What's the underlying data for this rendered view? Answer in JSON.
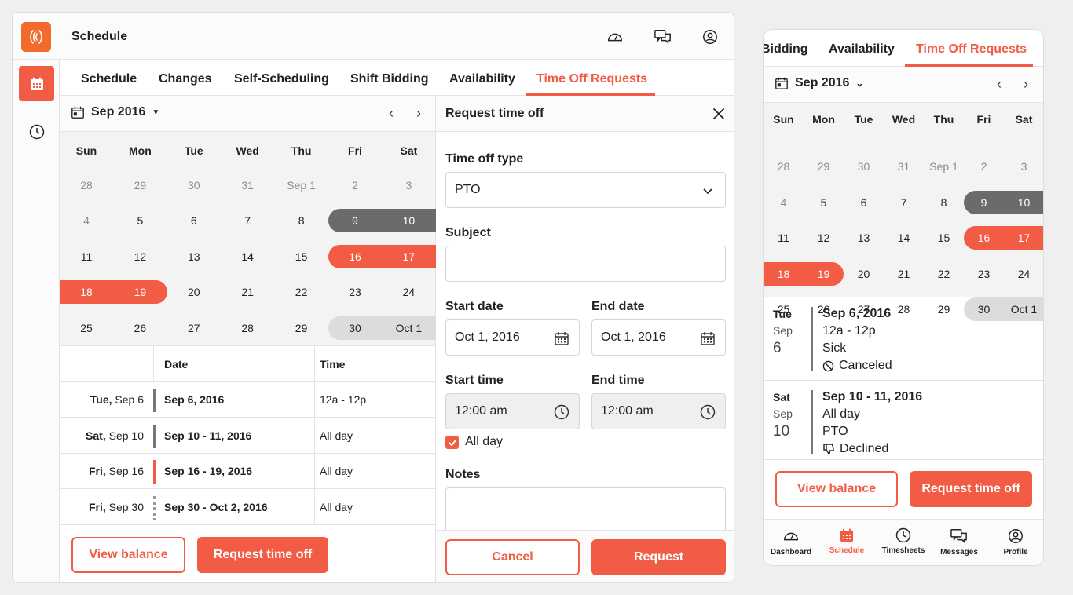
{
  "app": {
    "title": "Schedule"
  },
  "tabs": [
    "Schedule",
    "Changes",
    "Self-Scheduling",
    "Shift Bidding",
    "Availability",
    "Time Off Requests"
  ],
  "active_tab": "Time Off Requests",
  "calendar": {
    "month_label": "Sep 2016",
    "weekdays": [
      "Sun",
      "Mon",
      "Tue",
      "Wed",
      "Thu",
      "Fri",
      "Sat"
    ],
    "weeks": [
      [
        "28",
        "29",
        "30",
        "31",
        "Sep 1",
        "2",
        "3"
      ],
      [
        "4",
        "5",
        "6",
        "7",
        "8",
        "9",
        "10"
      ],
      [
        "11",
        "12",
        "13",
        "14",
        "15",
        "16",
        "17"
      ],
      [
        "18",
        "19",
        "20",
        "21",
        "22",
        "23",
        "24"
      ],
      [
        "25",
        "26",
        "27",
        "28",
        "29",
        "30",
        "Oct 1"
      ]
    ]
  },
  "table": {
    "headers": {
      "date": "Date",
      "time": "Time"
    },
    "rows": [
      {
        "day": "Tue,",
        "date_short": "Sep 6",
        "range": "Sep 6, 2016",
        "time": "12a - 12p",
        "color": "#777777"
      },
      {
        "day": "Sat,",
        "date_short": "Sep 10",
        "range": "Sep 10 - 11, 2016",
        "time": "All day",
        "color": "#777777"
      },
      {
        "day": "Fri,",
        "date_short": "Sep 16",
        "range": "Sep 16 - 19, 2016",
        "time": "All day",
        "color": "#f25c45"
      },
      {
        "day": "Fri,",
        "date_short": "Sep 30",
        "range": "Sep 30 - Oct 2, 2016",
        "time": "All day",
        "color": "#999999"
      }
    ]
  },
  "buttons": {
    "view_balance": "View balance",
    "request_time_off": "Request time off",
    "cancel": "Cancel",
    "request": "Request"
  },
  "form": {
    "title": "Request time off",
    "type_label": "Time off type",
    "type_value": "PTO",
    "subject_label": "Subject",
    "subject_value": "",
    "start_date_label": "Start date",
    "start_date_value": "Oct 1, 2016",
    "end_date_label": "End date",
    "end_date_value": "Oct 1, 2016",
    "start_time_label": "Start time",
    "start_time_value": "12:00 am",
    "end_time_label": "End time",
    "end_time_value": "12:00 am",
    "all_day_label": "All day",
    "all_day_checked": true,
    "notes_label": "Notes"
  },
  "mobile": {
    "tabs": [
      "Bidding",
      "Availability",
      "Time Off Requests"
    ],
    "month_label": "Sep 2016",
    "items": [
      {
        "dow": "Tue",
        "month": "Sep",
        "day": "6",
        "title": "Sep 6, 2016",
        "time": "12a - 12p",
        "type": "Sick",
        "status": "Canceled"
      },
      {
        "dow": "Sat",
        "month": "Sep",
        "day": "10",
        "title": "Sep 10 - 11, 2016",
        "time": "All day",
        "type": "PTO",
        "status": "Declined"
      }
    ],
    "nav": [
      "Dashboard",
      "Schedule",
      "Timesheets",
      "Messages",
      "Profile"
    ]
  },
  "colors": {
    "accent": "#f25c45",
    "brand": "#f26b2c",
    "dark_range": "#6b6b6e",
    "light_range": "#dcdcdc"
  }
}
